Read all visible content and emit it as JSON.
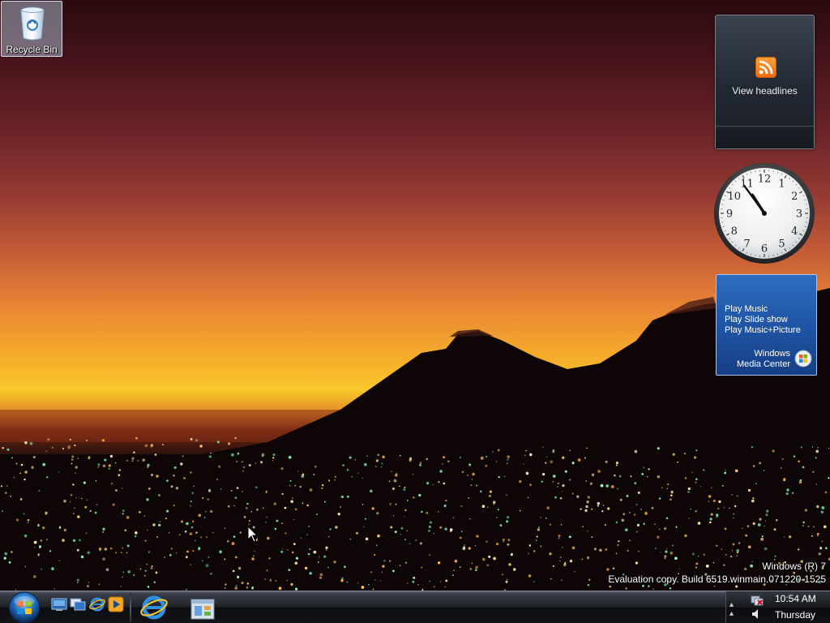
{
  "desktop": {
    "icons": [
      {
        "label": "Recycle Bin",
        "icon": "recycle-bin-icon"
      }
    ]
  },
  "gadgets": {
    "feed_headlines": {
      "label": "View headlines",
      "icon": "rss-icon"
    },
    "clock": {
      "numerals": [
        "12",
        "1",
        "2",
        "3",
        "4",
        "5",
        "6",
        "7",
        "8",
        "9",
        "10",
        "11"
      ],
      "hour": 10,
      "minute": 54
    },
    "media_center": {
      "items": [
        "Play Music",
        "Play Slide show",
        "Play Music+Picture"
      ],
      "brand_line1": "Windows",
      "brand_line2": "Media Center",
      "icon": "windows-flag-icon"
    }
  },
  "watermark": {
    "line1": "Windows (R) 7",
    "line2": "Evaluation copy. Build 6519.winmain.071220-1525"
  },
  "taskbar": {
    "start_icon": "windows-start-orb",
    "quick_launch": [
      {
        "name": "show-desktop-icon"
      },
      {
        "name": "switch-windows-icon"
      },
      {
        "name": "internet-explorer-icon"
      },
      {
        "name": "media-player-icon"
      }
    ],
    "pinned": [
      {
        "name": "internet-explorer-icon"
      },
      {
        "name": "windows-explorer-icon"
      }
    ],
    "tray": {
      "show_hidden": "show-hidden-icons",
      "network": "network-icon",
      "volume": "volume-icon",
      "time": "10:54 AM",
      "day": "Thursday"
    }
  },
  "colors": {
    "taskbar": "#15171b",
    "media_center_blue": "#1f55a5",
    "feed_gadget": "#222832"
  }
}
